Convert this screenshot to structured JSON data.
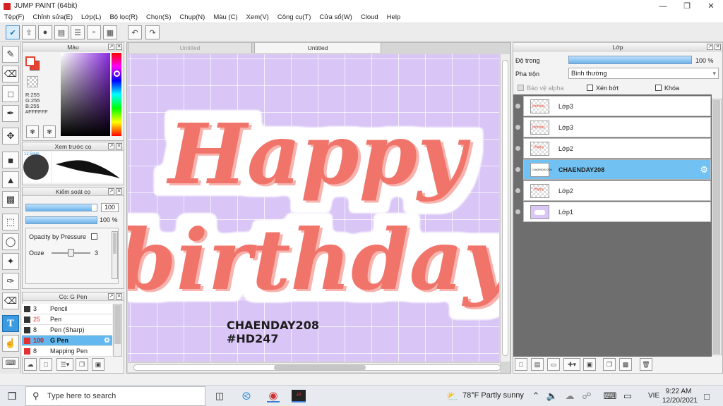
{
  "app": {
    "title": "JUMP PAINT (64bit)"
  },
  "menu": [
    "Tệp(F)",
    "Chỉnh sửa(E)",
    "Lớp(L)",
    "Bộ lọc(R)",
    "Chọn(S)",
    "Chụp(N)",
    "Màu (C)",
    "Xem(V)",
    "Công cụ(T)",
    "Cửa sổ(W)",
    "Cloud",
    "Help"
  ],
  "color_panel": {
    "title": "Màu",
    "r": "R:255",
    "g": "G:255",
    "b": "B:255",
    "hex": "#FFFFFF",
    "fg": "#e8412f",
    "bg": "#ffffff"
  },
  "brush_preview": {
    "title": "Xem trước cọ",
    "size": "12.5mm"
  },
  "brush_control": {
    "title": "Kiểm soát cọ",
    "size": "100",
    "size_fraction": 0.93,
    "opacity": "100 %",
    "opacity_fraction": 1.0,
    "opacity_pressure": "Opacity by Pressure",
    "ooze_label": "Ooze",
    "ooze_value": "3",
    "ooze_fraction": 0.45
  },
  "brush_list": {
    "title": "Cọ: G Pen",
    "items": [
      {
        "size": "3",
        "name": "Pencil",
        "color": "#333333"
      },
      {
        "size": "25",
        "name": "Pen",
        "color": "#333333"
      },
      {
        "size": "8",
        "name": "Pen (Sharp)",
        "color": "#333333"
      },
      {
        "size": "100",
        "name": "G Pen",
        "color": "#e33030"
      },
      {
        "size": "8",
        "name": "Mapping Pen",
        "color": "#e33030"
      }
    ]
  },
  "tabs": [
    {
      "label": "Untitled"
    },
    {
      "label": "Untitled"
    }
  ],
  "artwork": {
    "line1": "Happy",
    "line2": "birthday",
    "credit1": "CHAENDAY208",
    "credit2": "#HD247",
    "text_color": "#f1746a",
    "shadow_color": "#f7b4ae",
    "bg_color": "#d9c5f6"
  },
  "layer_panel": {
    "title": "Lớp",
    "opacity_label": "Độ trong",
    "opacity_value": "100 %",
    "opacity_fraction": 1.0,
    "blend_label": "Pha trộn",
    "blend_value": "Bình thường",
    "protect_alpha": "Bảo vệ alpha",
    "clipping": "Xén bớt",
    "lock": "Khóa",
    "layers": [
      {
        "name": "Lớp3",
        "thumb": "birthday"
      },
      {
        "name": "Lớp3",
        "thumb": "birthday"
      },
      {
        "name": "Lớp2",
        "thumb": "Happy"
      },
      {
        "name": "CHAENDAY208",
        "thumb": "CHAENDAY208"
      },
      {
        "name": "Lớp2",
        "thumb": "Happy"
      },
      {
        "name": "Lớp1",
        "thumb": ""
      }
    ]
  },
  "taskbar": {
    "search_placeholder": "Type here to search",
    "weather": "78°F  Partly sunny",
    "lang": "VIE",
    "time": "9:22 AM",
    "date": "12/20/2021"
  }
}
